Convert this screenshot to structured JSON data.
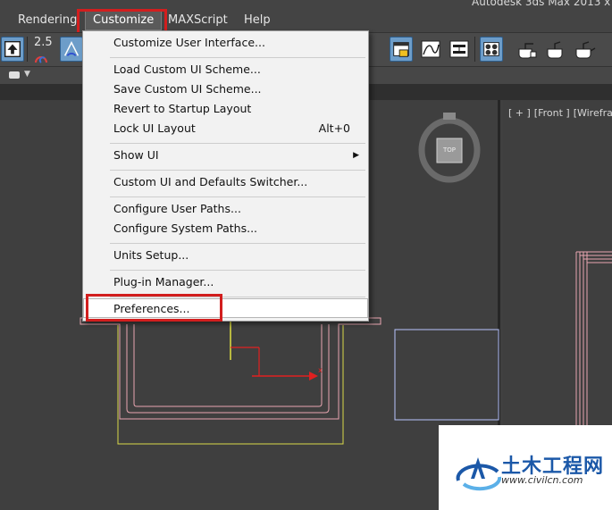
{
  "app": {
    "title": "Autodesk 3ds Max 2013 x"
  },
  "menubar": {
    "items": [
      "Rendering",
      "Customize",
      "MAXScript",
      "Help"
    ],
    "active": "Customize"
  },
  "toolbar": {
    "snap_value": "2.5"
  },
  "viewports": {
    "right_label": [
      "[ + ]",
      "[Front ]",
      "[Wireframe"
    ],
    "viewcube_face": "TOP"
  },
  "customize_menu": {
    "items": [
      {
        "label": "Customize User Interface...",
        "shortcut": ""
      },
      {
        "label": "Load Custom UI Scheme...",
        "shortcut": ""
      },
      {
        "label": "Save Custom UI Scheme...",
        "shortcut": ""
      },
      {
        "label": "Revert to Startup Layout",
        "shortcut": ""
      },
      {
        "label": "Lock UI Layout",
        "shortcut": "Alt+0"
      },
      {
        "label": "Show UI",
        "shortcut": "",
        "submenu": "▶"
      },
      {
        "label": "Custom UI and Defaults Switcher...",
        "shortcut": ""
      },
      {
        "label": "Configure User Paths...",
        "shortcut": ""
      },
      {
        "label": "Configure System Paths...",
        "shortcut": ""
      },
      {
        "label": "Units Setup...",
        "shortcut": ""
      },
      {
        "label": "Plug-in Manager...",
        "shortcut": ""
      },
      {
        "label": "Preferences...",
        "shortcut": ""
      }
    ],
    "highlighted": "Preferences..."
  },
  "watermark": {
    "title": "土木工程网",
    "url": "www.civilcn.com"
  },
  "colors": {
    "highlight_box": "#d21e1e",
    "viewport_bg": "#3f3f3f",
    "menu_bg": "#f2f2f2",
    "watermark_blue": "#1b58a8"
  }
}
